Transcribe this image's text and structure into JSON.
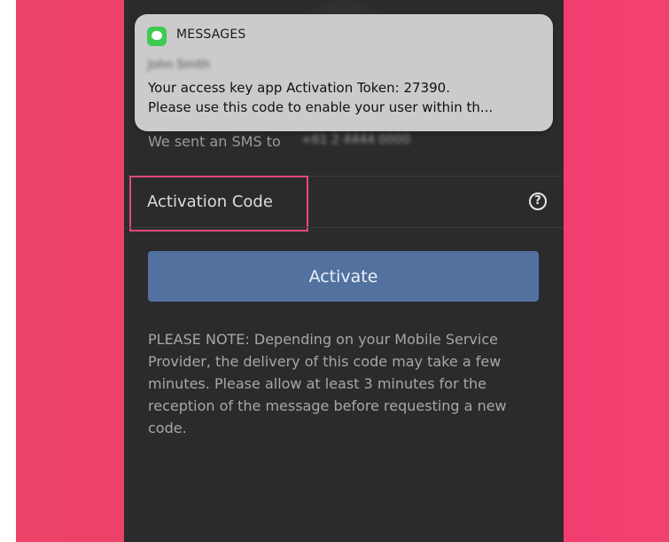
{
  "notification": {
    "app_icon": "messages-bubble-icon",
    "app_name": "MESSAGES",
    "sender": "John Smith",
    "body": "Your access key app Activation Token: 27390.\nPlease use this code to enable your user within th..."
  },
  "sms": {
    "sent_label": "We sent an SMS to",
    "phone_masked": "+61 2 4444 0000"
  },
  "activation": {
    "placeholder": "Activation Code",
    "value": "",
    "help_icon": "question-circle-icon",
    "help_glyph": "?"
  },
  "activate_button": {
    "label": "Activate"
  },
  "note": {
    "text": "PLEASE NOTE: Depending on your Mobile Service Provider, the delivery of this code may take a few minutes. Please allow at least 3 minutes for the reception of the message before requesting a new code."
  },
  "colors": {
    "background": "#ee3d68",
    "panel": "#2b2b2d",
    "button": "#53719f",
    "highlight": "#e24a78",
    "notification": "#cbcbcd",
    "messages_green": "#3dcb50"
  }
}
